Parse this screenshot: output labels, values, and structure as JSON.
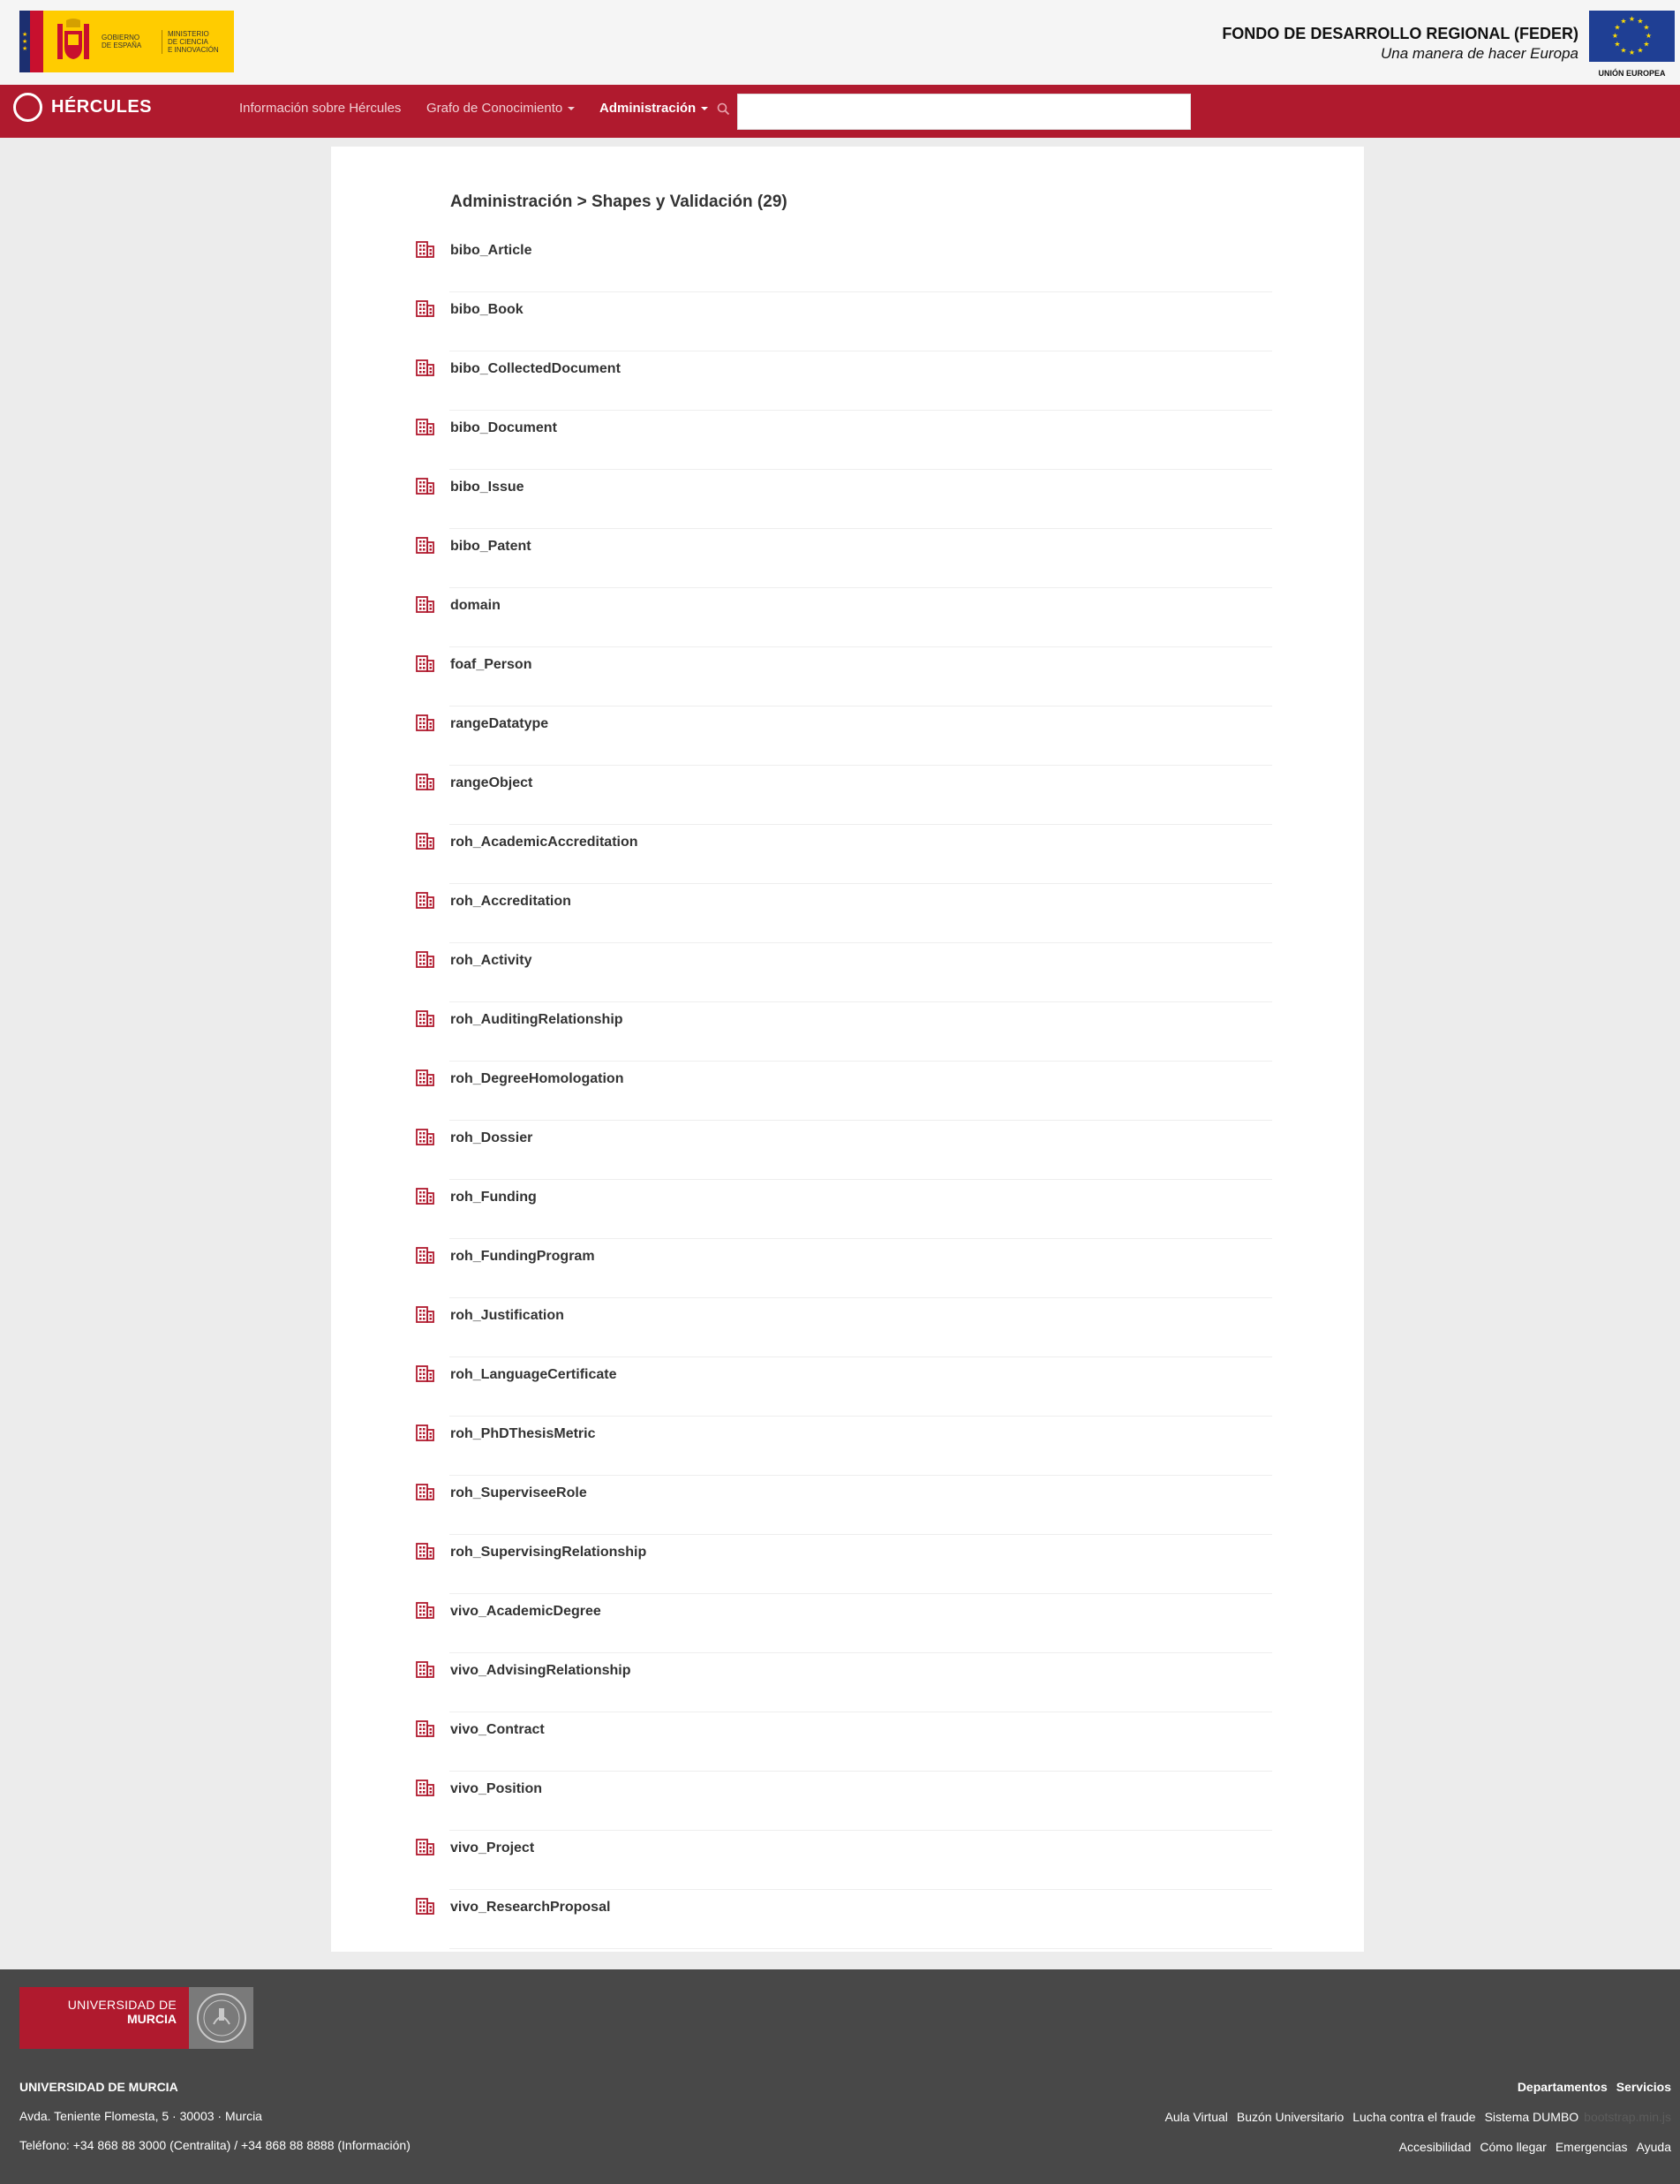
{
  "header": {
    "gobierno_line1": "Gobierno",
    "gobierno_line2": "de España",
    "ministerio_line1": "Ministerio",
    "ministerio_line2": "de Ciencia",
    "ministerio_line3": "e Innovación",
    "feder_title": "FONDO DE DESARROLLO REGIONAL (FEDER)",
    "feder_subtitle": "Una manera de hacer Europa",
    "eu_label": "UNIÓN EUROPEA"
  },
  "navbar": {
    "brand": "HÉRCULES",
    "links": [
      {
        "label": "Información sobre Hércules"
      },
      {
        "label": "Grafo de Conocimiento"
      },
      {
        "label": "Administración"
      }
    ],
    "search_value": ""
  },
  "main": {
    "heading": "Administración > Shapes y Validación (29)",
    "items": [
      "bibo_Article",
      "bibo_Book",
      "bibo_CollectedDocument",
      "bibo_Document",
      "bibo_Issue",
      "bibo_Patent",
      "domain",
      "foaf_Person",
      "rangeDatatype",
      "rangeObject",
      "roh_AcademicAccreditation",
      "roh_Accreditation",
      "roh_Activity",
      "roh_AuditingRelationship",
      "roh_DegreeHomologation",
      "roh_Dossier",
      "roh_Funding",
      "roh_FundingProgram",
      "roh_Justification",
      "roh_LanguageCertificate",
      "roh_PhDThesisMetric",
      "roh_SuperviseeRole",
      "roh_SupervisingRelationship",
      "vivo_AcademicDegree",
      "vivo_AdvisingRelationship",
      "vivo_Contract",
      "vivo_Position",
      "vivo_Project",
      "vivo_ResearchProposal"
    ],
    "item_icon": "building-icon"
  },
  "footer": {
    "logo_line1": "UNIVERSIDAD DE",
    "logo_line2": "MURCIA",
    "name": "UNIVERSIDAD DE MURCIA",
    "address": "Avda. Teniente Flomesta, 5 · 30003 · Murcia",
    "phone": "Teléfono: +34 868 88 3000 (Centralita) / +34 868 88 8888 (Información)",
    "links_row1": [
      "Departamentos",
      "Servicios"
    ],
    "links_row2": [
      "Aula Virtual",
      "Buzón Universitario",
      "Lucha contra el fraude",
      "Sistema DUMBO"
    ],
    "links_row2_faint": "bootstrap.min.js",
    "links_row3": [
      "Accesibilidad",
      "Cómo llegar",
      "Emergencias",
      "Ayuda"
    ]
  },
  "colors": {
    "brand_red": "#b01a2e",
    "footer_bg": "#484848",
    "gob_yellow": "#ffcc00",
    "eu_blue": "#1f3f94"
  }
}
